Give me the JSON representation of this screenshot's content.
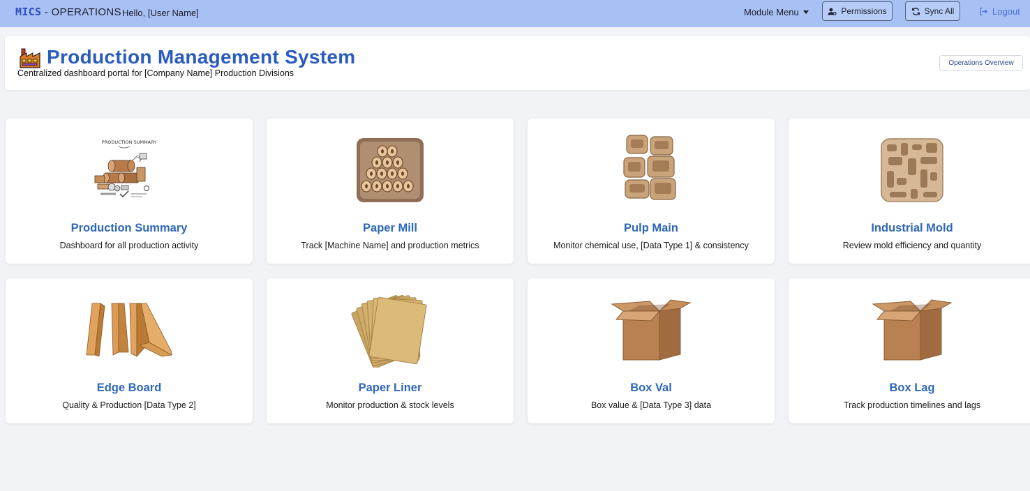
{
  "navbar": {
    "brand_strong": "MICS",
    "brand_rest": " - OPERATIONS",
    "greeting": "Hello, [User Name]",
    "module_menu": "Module Menu",
    "permissions": "Permissions",
    "sync_all": "Sync All",
    "logout": "Logout"
  },
  "header": {
    "title": "Production Management System",
    "subtitle": "Centralized dashboard portal for [Company Name] Production Divisions",
    "overview_button": "Operations Overview"
  },
  "modules": [
    {
      "title": "Production Summary",
      "description": "Dashboard for all production activity",
      "icon": "production-summary-illustration",
      "image_text": "PRODUCTION SUMMARY"
    },
    {
      "title": "Paper Mill",
      "description": "Track [Machine Name] and production metrics",
      "icon": "paper-rolls-icon"
    },
    {
      "title": "Pulp Main",
      "description": "Monitor chemical use, [Data Type 1] & consistency",
      "icon": "pulp-trays-icon"
    },
    {
      "title": "Industrial Mold",
      "description": "Review mold efficiency and quantity",
      "icon": "mold-tray-icon"
    },
    {
      "title": "Edge Board",
      "description": "Quality & Production [Data Type 2]",
      "icon": "edge-board-icon"
    },
    {
      "title": "Paper Liner",
      "description": "Monitor production & stock levels",
      "icon": "paper-sheets-icon"
    },
    {
      "title": "Box Val",
      "description": "Box value & [Data Type 3] data",
      "icon": "cardboard-box-icon"
    },
    {
      "title": "Box Lag",
      "description": "Track production timelines and lags",
      "icon": "cardboard-box-icon"
    }
  ],
  "colors": {
    "navbar": "#a8c1f5",
    "accent": "#2a5bbf",
    "card_title": "#2e67b8",
    "page_bg": "#f1f3f6"
  }
}
